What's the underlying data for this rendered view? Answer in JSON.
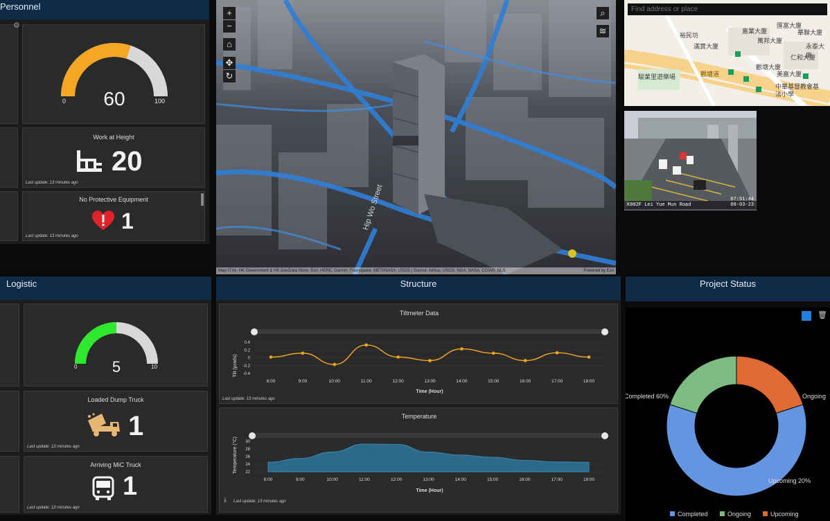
{
  "personnel": {
    "title": "Personnel",
    "gauge": {
      "value": "60",
      "min": "0",
      "max": "100",
      "level": 0.6
    },
    "work_at_height": {
      "title": "Work at Height",
      "value": "20",
      "update": "Last update: 13 minutes ago"
    },
    "no_ppe": {
      "title": "No Protective Equipment",
      "value": "1",
      "update": "Last update: 13 minutes ago"
    }
  },
  "map3d": {
    "street_label": "Hip Wo Street",
    "attribution": "Map-IT.hk, HK Government & HK GeoData Store, Esri, HERE, Garmin, Foursquare, METI/NASA, USGS | Source: Airbus, USGS, NGA, NASA, CGIAR, NLS",
    "powered": "Powered by Esri",
    "controls": {
      "zoom_in": "+",
      "zoom_out": "−",
      "home": "⌂",
      "pan": "✥",
      "rotate": "↻",
      "search": "⌕",
      "layers": "≋"
    }
  },
  "map2d": {
    "search_placeholder": "Find address or place",
    "labels": [
      "裕民坊",
      "駿業里遊樂場",
      "觀塘道",
      "嘉業大廈",
      "觀塘大廈",
      "匯富大廈",
      "華聯大廈",
      "永泰大廈",
      "仁和大廈",
      "中華基督教會基法小學",
      "萬邦大廈",
      "滿寶大廈",
      "美嘉大廈"
    ]
  },
  "cctv": {
    "caption": "K802F Lei Yue Mun Road",
    "time": "07:51:44",
    "date": "08-03-23"
  },
  "logistic": {
    "title": "Logistic",
    "gauge": {
      "value": "5",
      "min": "0",
      "max": "10",
      "level": 0.5
    },
    "dump_truck": {
      "title": "Loaded Dump Truck",
      "value": "1",
      "update": "Last update: 13 minutes ago"
    },
    "mic_truck": {
      "title": "Arriving MiC Truck",
      "value": "1",
      "update": "Last update: 13 minutes ago"
    }
  },
  "structure": {
    "title": "Structure",
    "tilt_update": "Last update: 13 minutes ago",
    "temp_update": "Last update: 13 minutes ago"
  },
  "project_status": {
    "title": "Project Status"
  },
  "colors": {
    "header": "#0d2b47",
    "gauge_orange": "#f5a623",
    "gauge_green": "#2ee82e",
    "line_orange": "#f5a623",
    "area_blue": "#2b6a8a",
    "completed": "#6495e0",
    "ongoing": "#7dbb82",
    "upcoming": "#e06a33"
  },
  "chart_data": [
    {
      "type": "line",
      "title": "Tiltmeter Data",
      "xlabel": "Time (Hour)",
      "ylabel": "Tilt (µrads)",
      "x": [
        "8:00",
        "9:00",
        "10:00",
        "11:00",
        "12:00",
        "13:00",
        "14:00",
        "15:00",
        "16:00",
        "17:00",
        "18:00"
      ],
      "series": [
        {
          "values": [
            0.02,
            0.12,
            -0.17,
            0.33,
            0.02,
            -0.07,
            0.23,
            0.12,
            -0.07,
            0.13,
            0.02
          ]
        }
      ],
      "yticks": [
        "0.4",
        "0.2",
        "0",
        "-0.2",
        "-0.4"
      ],
      "ylim": [
        -0.4,
        0.4
      ],
      "grid": true
    },
    {
      "type": "area",
      "title": "Temperature",
      "xlabel": "Time (Hour)",
      "ylabel": "Temperature (°C)",
      "x": [
        "8:00",
        "9:00",
        "10:00",
        "11:00",
        "12:00",
        "13:00",
        "14:00",
        "15:00",
        "16:00",
        "17:00",
        "18:00"
      ],
      "series": [
        {
          "values": [
            24.5,
            25.5,
            27.2,
            29.3,
            29.2,
            27.2,
            26.4,
            25.8,
            25.0,
            24.6,
            24.5
          ]
        }
      ],
      "yticks": [
        "30",
        "28",
        "26",
        "24",
        "22"
      ],
      "ylim": [
        22,
        30
      ],
      "grid": true
    },
    {
      "type": "pie",
      "labels": [
        "Completed",
        "Ongoing",
        "Upcoming"
      ],
      "values": [
        60,
        20,
        20
      ],
      "slice_labels": [
        "Completed 60%",
        "Ongoing",
        "Upcoming 20%"
      ],
      "colors": [
        "#6495e0",
        "#7dbb82",
        "#e06a33"
      ],
      "legend": "bottom"
    }
  ]
}
